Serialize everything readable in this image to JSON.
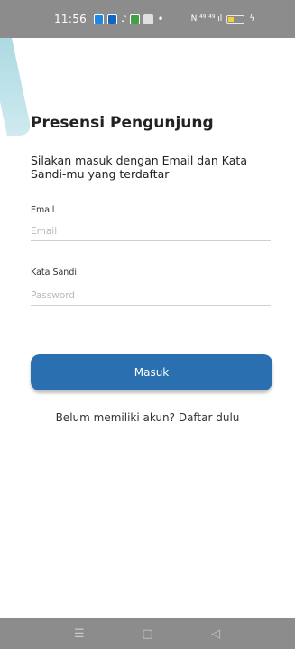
{
  "status_bar": {
    "time": "11:56",
    "app_icons": [
      {
        "name": "app-icon-1",
        "color": "#1e88e5"
      },
      {
        "name": "app-icon-2",
        "color": "#1e88e5"
      },
      {
        "name": "tiktok-icon",
        "color": "#ffffff"
      },
      {
        "name": "app-icon-4",
        "color": "#1e88e5"
      },
      {
        "name": "app-icon-5",
        "color": "#ffffff"
      }
    ],
    "dot": "•",
    "network_labels": "N  ⁴⁹  ⁴⁹ ıl",
    "battery_level": 0.3
  },
  "page": {
    "title": "Presensi Pengunjung",
    "subtitle": "Silakan masuk dengan Email dan Kata Sandi-mu yang terdaftar"
  },
  "form": {
    "email_label": "Email",
    "email_placeholder": "Email",
    "password_label": "Kata Sandi",
    "password_placeholder": "Password",
    "submit_label": "Masuk"
  },
  "register": {
    "text": "Belum memiliki akun? Daftar dulu"
  },
  "nav": {
    "menu_glyph": "☰",
    "home_glyph": "▢",
    "back_glyph": "◁"
  },
  "colors": {
    "primary": "#2a70b1",
    "status_bar_bg": "#8c8c8c",
    "accent_decor": "#9fd3dc"
  }
}
